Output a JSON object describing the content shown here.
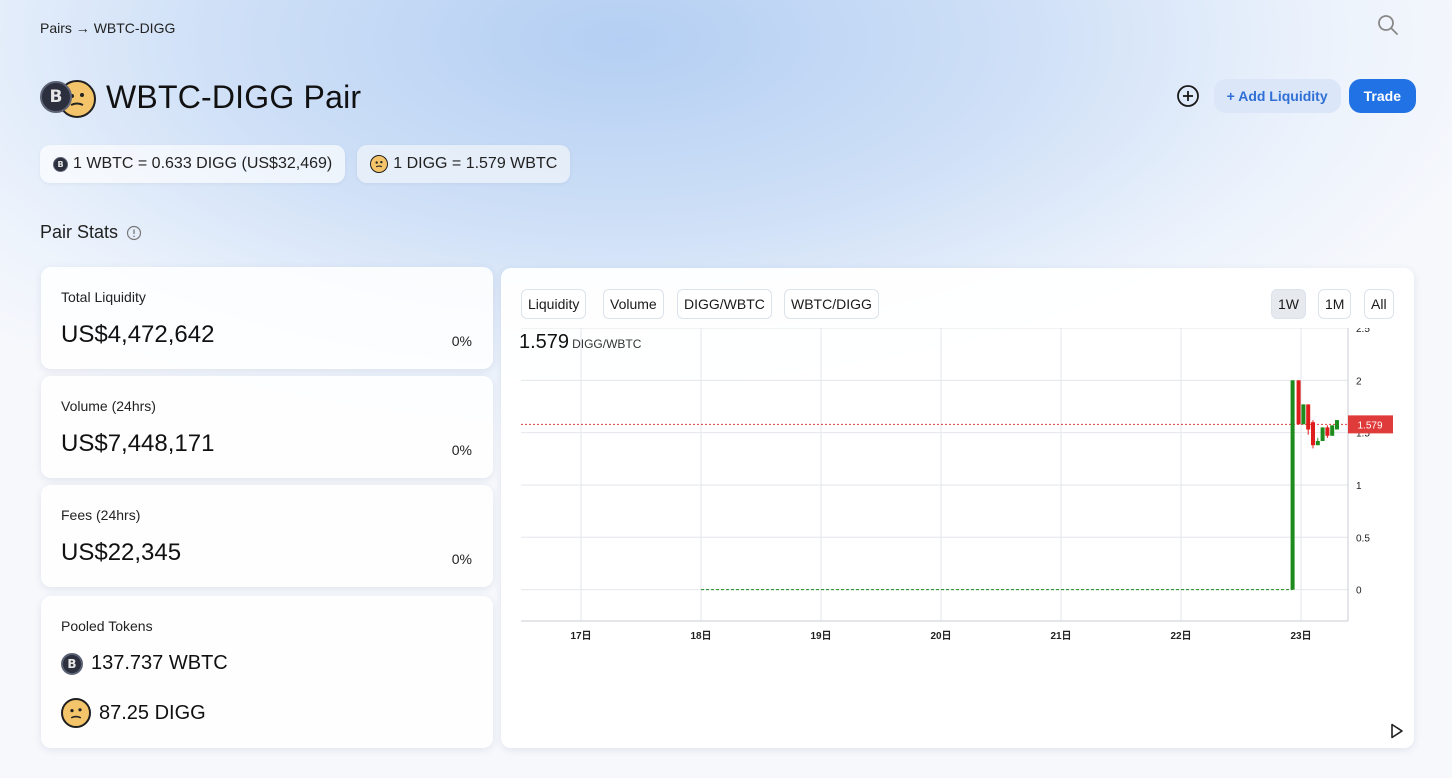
{
  "breadcrumb": {
    "pairs_label": "Pairs",
    "arrow": "→",
    "current": "WBTC-DIGG"
  },
  "header": {
    "title": "WBTC-DIGG Pair",
    "add_liquidity_label": "+ Add Liquidity",
    "trade_label": "Trade"
  },
  "rates": {
    "wbtc_rate": "1 WBTC = 0.633 DIGG (US$32,469)",
    "digg_rate": "1 DIGG = 1.579 WBTC"
  },
  "section": {
    "title": "Pair Stats"
  },
  "stats": {
    "total_liquidity": {
      "label": "Total Liquidity",
      "value": "US$4,472,642",
      "change": "0%"
    },
    "volume": {
      "label": "Volume (24hrs)",
      "value": "US$7,448,171",
      "change": "0%"
    },
    "fees": {
      "label": "Fees (24hrs)",
      "value": "US$22,345",
      "change": "0%"
    },
    "pooled": {
      "label": "Pooled Tokens",
      "wbtc": "137.737 WBTC",
      "digg": "87.25 DIGG"
    }
  },
  "chart_tabs": {
    "liquidity": "Liquidity",
    "volume": "Volume",
    "digg_wbtc": "DIGG/WBTC",
    "wbtc_digg": "WBTC/DIGG",
    "range_1w": "1W",
    "range_1m": "1M",
    "range_all": "All"
  },
  "chart_header": {
    "price": "1.579",
    "unit": "DIGG/WBTC"
  },
  "icons": {
    "search": "search-icon",
    "add": "plus-circle-icon",
    "info": "info-icon",
    "wbtc": "wbtc-token-icon",
    "digg": "digg-token-icon",
    "play": "play-icon"
  },
  "colors": {
    "accent": "#2172e5",
    "up": "#1e8b1e",
    "down": "#e01d1d",
    "price_line": "#e03b3b",
    "baseline": "#1e8b1e"
  },
  "chart_data": {
    "type": "candlestick",
    "x_ticks": [
      "17日",
      "18日",
      "19日",
      "20日",
      "21日",
      "22日",
      "23日"
    ],
    "y_ticks": [
      0,
      0.5,
      1,
      1.5,
      2,
      2.5
    ],
    "ylim": [
      -0.3,
      2.5
    ],
    "current_price": 1.579,
    "current_price_label": "1.579",
    "baseline_value": 0,
    "baseline_from_day": 18,
    "candles": [
      {
        "t": 22.93,
        "o": 0,
        "h": 2,
        "l": 0,
        "c": 2
      },
      {
        "t": 22.98,
        "o": 2,
        "h": 2,
        "l": 1.58,
        "c": 1.58
      },
      {
        "t": 23.02,
        "o": 1.58,
        "h": 1.77,
        "l": 1.58,
        "c": 1.77
      },
      {
        "t": 23.06,
        "o": 1.77,
        "h": 1.77,
        "l": 1.48,
        "c": 1.53
      },
      {
        "t": 23.1,
        "o": 1.6,
        "h": 1.62,
        "l": 1.35,
        "c": 1.38
      },
      {
        "t": 23.14,
        "o": 1.38,
        "h": 1.45,
        "l": 1.38,
        "c": 1.42
      },
      {
        "t": 23.18,
        "o": 1.42,
        "h": 1.55,
        "l": 1.42,
        "c": 1.55
      },
      {
        "t": 23.22,
        "o": 1.55,
        "h": 1.57,
        "l": 1.45,
        "c": 1.47
      },
      {
        "t": 23.26,
        "o": 1.47,
        "h": 1.57,
        "l": 1.47,
        "c": 1.57
      },
      {
        "t": 23.3,
        "o": 1.53,
        "h": 1.62,
        "l": 1.53,
        "c": 1.62
      }
    ]
  }
}
